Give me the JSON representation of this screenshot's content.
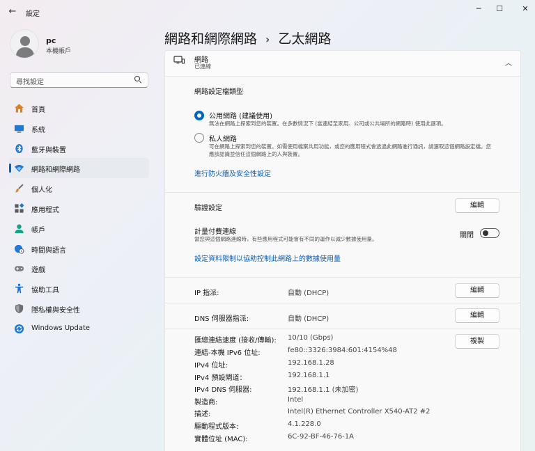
{
  "window": {
    "title": "設定",
    "controls": {
      "minimize": "─",
      "maximize": "☐",
      "close": "✕"
    }
  },
  "profile": {
    "name": "pc",
    "account_type": "本機帳戶"
  },
  "search": {
    "placeholder": "尋找設定"
  },
  "sidebar": {
    "items": [
      {
        "label": "首頁",
        "icon": "home-icon",
        "color": "#d9822b"
      },
      {
        "label": "系統",
        "icon": "monitor-icon",
        "color": "#1f7ad4"
      },
      {
        "label": "藍牙與裝置",
        "icon": "bluetooth-icon",
        "color": "#1f7ad4"
      },
      {
        "label": "網路和網際網路",
        "icon": "wifi-icon",
        "color": "#1f7ad4",
        "active": true
      },
      {
        "label": "個人化",
        "icon": "brush-icon",
        "color": "#d9822b"
      },
      {
        "label": "應用程式",
        "icon": "apps-icon",
        "color": "#555a63"
      },
      {
        "label": "帳戶",
        "icon": "person-icon",
        "color": "#19a08a"
      },
      {
        "label": "時間與語言",
        "icon": "globe-clock-icon",
        "color": "#1f7ad4"
      },
      {
        "label": "遊戲",
        "icon": "gamepad-icon",
        "color": "#7b7f86"
      },
      {
        "label": "協助工具",
        "icon": "accessibility-icon",
        "color": "#1f6fd1"
      },
      {
        "label": "隱私權與安全性",
        "icon": "shield-icon",
        "color": "#6b6f76"
      },
      {
        "label": "Windows Update",
        "icon": "update-icon",
        "color": "#1f7ad4"
      }
    ]
  },
  "header": {
    "parent": "網路和網際網路",
    "separator": "›",
    "current": "乙太網路"
  },
  "network_card": {
    "title": "網路",
    "status": "已連線",
    "profile_type_title": "網路設定檔類型",
    "public": {
      "label": "公用網路 (建議使用)",
      "desc": "無法在網路上探索到您的裝置。在多數情況下 (當連結至家用、公司或公共場所的網路時) 使用此選項。"
    },
    "private": {
      "label": "私人網路",
      "desc": "可在網路上探索到您的裝置。如需使用檔案共用功能，或您的應用程式會透過此網路進行通訊，請選取這個網路設定檔。您應該認識並信任這個網路上的人與裝置。"
    },
    "firewall_link": "進行防火牆及安全性設定"
  },
  "auth": {
    "label": "驗證設定",
    "button": "編輯"
  },
  "metered": {
    "label": "計量付費連線",
    "desc": "當您與這個網路連線時，有些應用程式可能會有不同的運作以減少數據使用量。",
    "state": "關閉",
    "link": "設定資料限制以協助控制此網路上的數據使用量"
  },
  "ip": {
    "label": "IP 指派:",
    "value": "自動 (DHCP)",
    "button": "編輯"
  },
  "dns": {
    "label": "DNS 伺服器指派:",
    "value": "自動 (DHCP)",
    "button": "編輯"
  },
  "properties": {
    "copy_button": "複製",
    "rows": [
      {
        "label": "匯總連結速度 (接收/傳輸):",
        "value": "10/10 (Gbps)"
      },
      {
        "label": "連結-本機 IPv6 位址:",
        "value": "fe80::3326:3984:601:4154%48"
      },
      {
        "label": "IPv4 位址:",
        "value": "192.168.1.28"
      },
      {
        "label": "IPv4 預設閘道：",
        "value": "192.168.1.1"
      },
      {
        "label": "IPv4 DNS 伺服器:",
        "value": "192.168.1.1 (未加密)"
      },
      {
        "label": "製造商:",
        "value": "Intel"
      },
      {
        "label": "描述:",
        "value": "Intel(R) Ethernet Controller X540-AT2 #2"
      },
      {
        "label": "驅動程式版本:",
        "value": "4.1.228.0"
      },
      {
        "label": "實體位址 (MAC):",
        "value": "6C-92-BF-46-76-1A"
      }
    ]
  },
  "accent_color": "#0067c0",
  "link_color": "#0a5fb4"
}
